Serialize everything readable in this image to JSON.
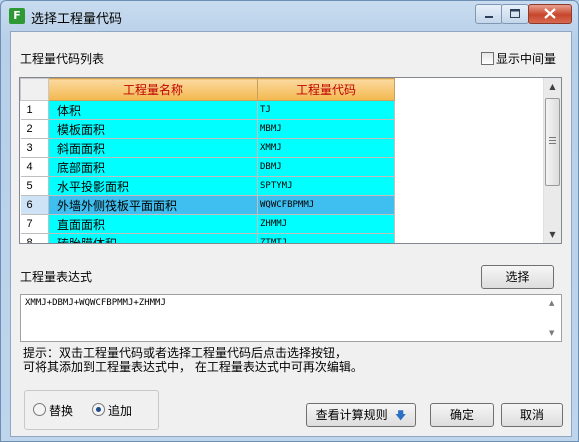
{
  "window": {
    "title": "选择工程量代码",
    "icon": "app-icon",
    "icon_glyph": "F"
  },
  "list_label": "工程量代码列表",
  "show_intermediate_label": "显示中间量",
  "table": {
    "headers": [
      "工程量名称",
      "工程量代码"
    ],
    "rows": [
      {
        "index": "1",
        "name": "体积",
        "code": "TJ"
      },
      {
        "index": "2",
        "name": "模板面积",
        "code": "MBMJ"
      },
      {
        "index": "3",
        "name": "斜面面积",
        "code": "XMMJ"
      },
      {
        "index": "4",
        "name": "底部面积",
        "code": "DBMJ"
      },
      {
        "index": "5",
        "name": "水平投影面积",
        "code": "SPTYMJ"
      },
      {
        "index": "6",
        "name": "外墙外侧筏板平面面积",
        "code": "WQWCFBPMMJ"
      },
      {
        "index": "7",
        "name": "直面面积",
        "code": "ZHMMJ"
      },
      {
        "index": "8",
        "name": "砖胎膜体积",
        "code": "ZTMTJ"
      }
    ],
    "selected_index": "6"
  },
  "expression_label": "工程量表达式",
  "select_button": "选择",
  "expression_value": "XMMJ+DBMJ+WQWCFBPMMJ+ZHMMJ",
  "hint_line1": "提示：双击工程量代码或者选择工程量代码后点击选择按钮，",
  "hint_line2": "可将其添加到工程量表达式中， 在工程量表达式中可再次编辑。",
  "mode": {
    "options": [
      "替换",
      "追加"
    ],
    "selected": "追加"
  },
  "view_rules_button": "查看计算规则",
  "ok_button": "确定",
  "cancel_button": "取消",
  "colors": {
    "cell_bg": "#00ffff",
    "selected_bg": "#3fbff0",
    "header_text": "#c00000"
  }
}
